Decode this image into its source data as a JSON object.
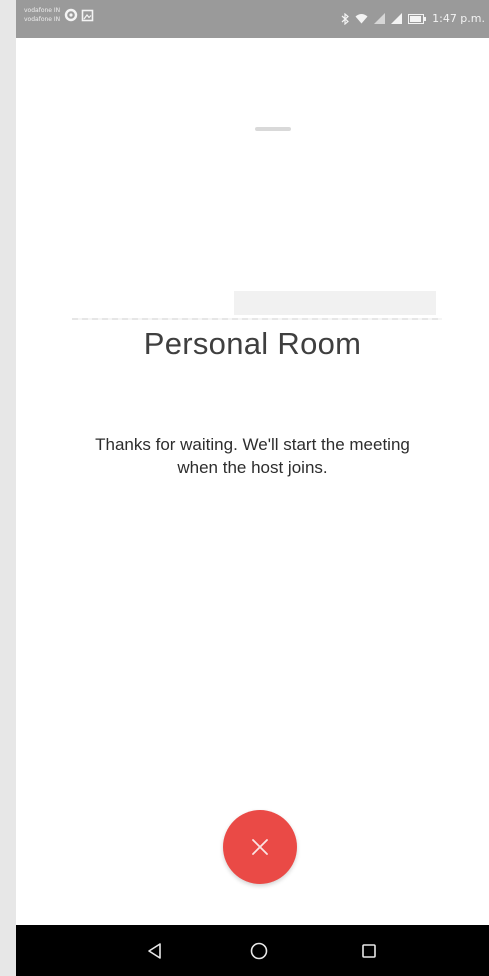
{
  "status_bar": {
    "carrier_line_1": "vodafone IN",
    "carrier_line_2": "vodafone IN",
    "time": "1:47 p.m."
  },
  "meeting": {
    "title": "Personal Room",
    "waiting_message": "Thanks for waiting. We'll start the meeting when the host joins."
  },
  "icons": {
    "leave": "close-icon",
    "back": "nav-back-icon",
    "home": "nav-home-icon",
    "recents": "nav-recents-icon"
  },
  "colors": {
    "accent_red": "#ea4a46",
    "status_bar": "#9a9a9a",
    "nav_bar": "#000000"
  }
}
